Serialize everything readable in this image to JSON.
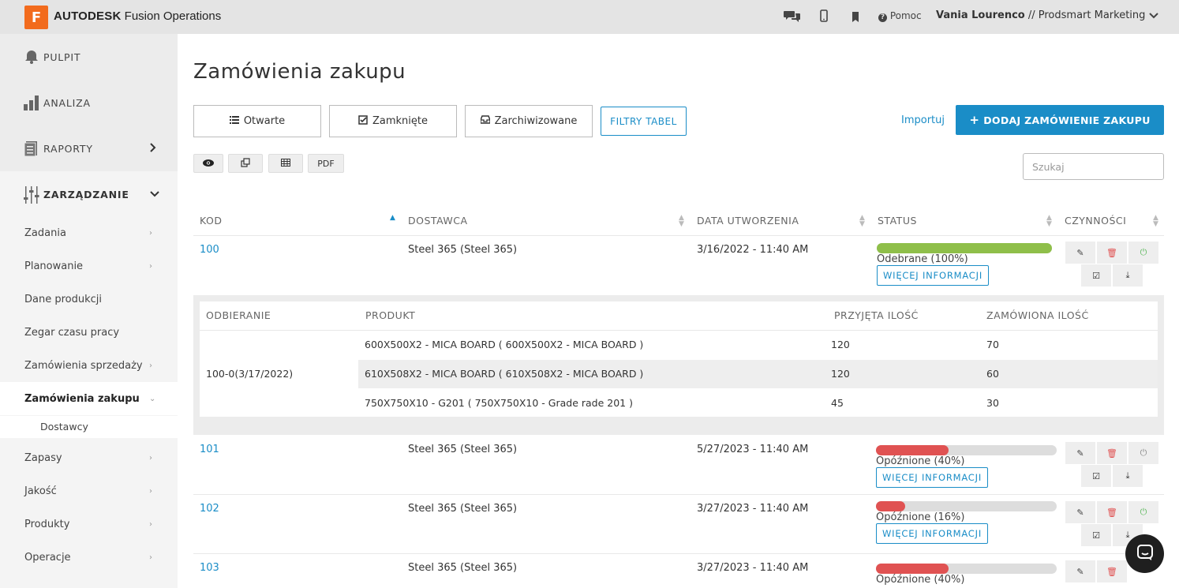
{
  "topbar": {
    "logo_letter": "F",
    "brand_bold": "AUTODESK",
    "brand_rest": " Fusion Operations",
    "help_label": "Pomoc",
    "user_name": "Vania Lourenco",
    "user_org": " // Prodsmart Marketing"
  },
  "sidebar": {
    "top_items": [
      {
        "label": "PULPIT",
        "icon": "bell-icon"
      },
      {
        "label": "ANALIZA",
        "icon": "bar-chart-icon"
      },
      {
        "label": "RAPORTY",
        "icon": "document-icon"
      },
      {
        "label": "ZARZĄDZANIE",
        "icon": "sliders-icon"
      }
    ],
    "items": [
      {
        "label": "Zadania"
      },
      {
        "label": "Planowanie"
      },
      {
        "label": "Dane produkcji"
      },
      {
        "label": "Zegar czasu pracy"
      },
      {
        "label": "Zamówienia sprzedaży"
      },
      {
        "label": "Zamówienia zakupu"
      },
      {
        "label": "Dostawcy"
      },
      {
        "label": "Zapasy"
      },
      {
        "label": "Jakość"
      },
      {
        "label": "Produkty"
      },
      {
        "label": "Operacje"
      }
    ]
  },
  "main": {
    "title": "Zamówienia zakupu",
    "tabs": [
      {
        "label": "Otwarte",
        "icon": "list-icon"
      },
      {
        "label": "Zamknięte",
        "icon": "check-square-icon"
      },
      {
        "label": "Zarchiwizowane",
        "icon": "inbox-icon"
      }
    ],
    "filters_label": "FILTRY TABEL",
    "import_label": "Importuj",
    "add_label": "DODAJ ZAMÓWIENIE ZAKUPU",
    "pdf_label": "PDF",
    "search_placeholder": "Szukaj"
  },
  "table": {
    "headers": [
      "KOD",
      "DOSTAWCA",
      "DATA UTWORZENIA",
      "STATUS",
      "CZYNNOŚCI"
    ],
    "more_label": "WIĘCEJ INFORMACJI",
    "rows": [
      {
        "kod": "100",
        "dostawca": "Steel 365 (Steel 365)",
        "data": "3/16/2022 - 11:40 AM",
        "status": "Odebrane (100%)",
        "progress": 1.0,
        "color": "#8fbf4a"
      },
      {
        "kod": "101",
        "dostawca": "Steel 365 (Steel 365)",
        "data": "5/27/2023 - 11:40 AM",
        "status": "Opóźnione (40%)",
        "progress": 0.4,
        "color": "#e05252"
      },
      {
        "kod": "102",
        "dostawca": "Steel 365 (Steel 365)",
        "data": "3/27/2023 - 11:40 AM",
        "status": "Opóźnione (16%)",
        "progress": 0.16,
        "color": "#e05252"
      },
      {
        "kod": "103",
        "dostawca": "Steel 365 (Steel 365)",
        "data": "3/27/2023 - 11:40 AM",
        "status": "Opóźnione (40%)",
        "progress": 0.4,
        "color": "#e05252"
      }
    ]
  },
  "detail": {
    "headers": [
      "ODBIERANIE",
      "PRODUKT",
      "PRZYJĘTA ILOŚĆ",
      "ZAMÓWIONA ILOŚĆ"
    ],
    "receipt": "100-0(3/17/2022)",
    "rows": [
      {
        "produkt": "600X500X2 - MICA BOARD ( 600X500X2 - MICA BOARD )",
        "przyjeta": "120",
        "zamowiona": "70"
      },
      {
        "produkt": "610X508X2 - MICA BOARD ( 610X508X2 - MICA BOARD )",
        "przyjeta": "120",
        "zamowiona": "60"
      },
      {
        "produkt": "750X750X10 - G201 ( 750X750X10 - Grade rade 201 )",
        "przyjeta": "45",
        "zamowiona": "30"
      }
    ]
  }
}
